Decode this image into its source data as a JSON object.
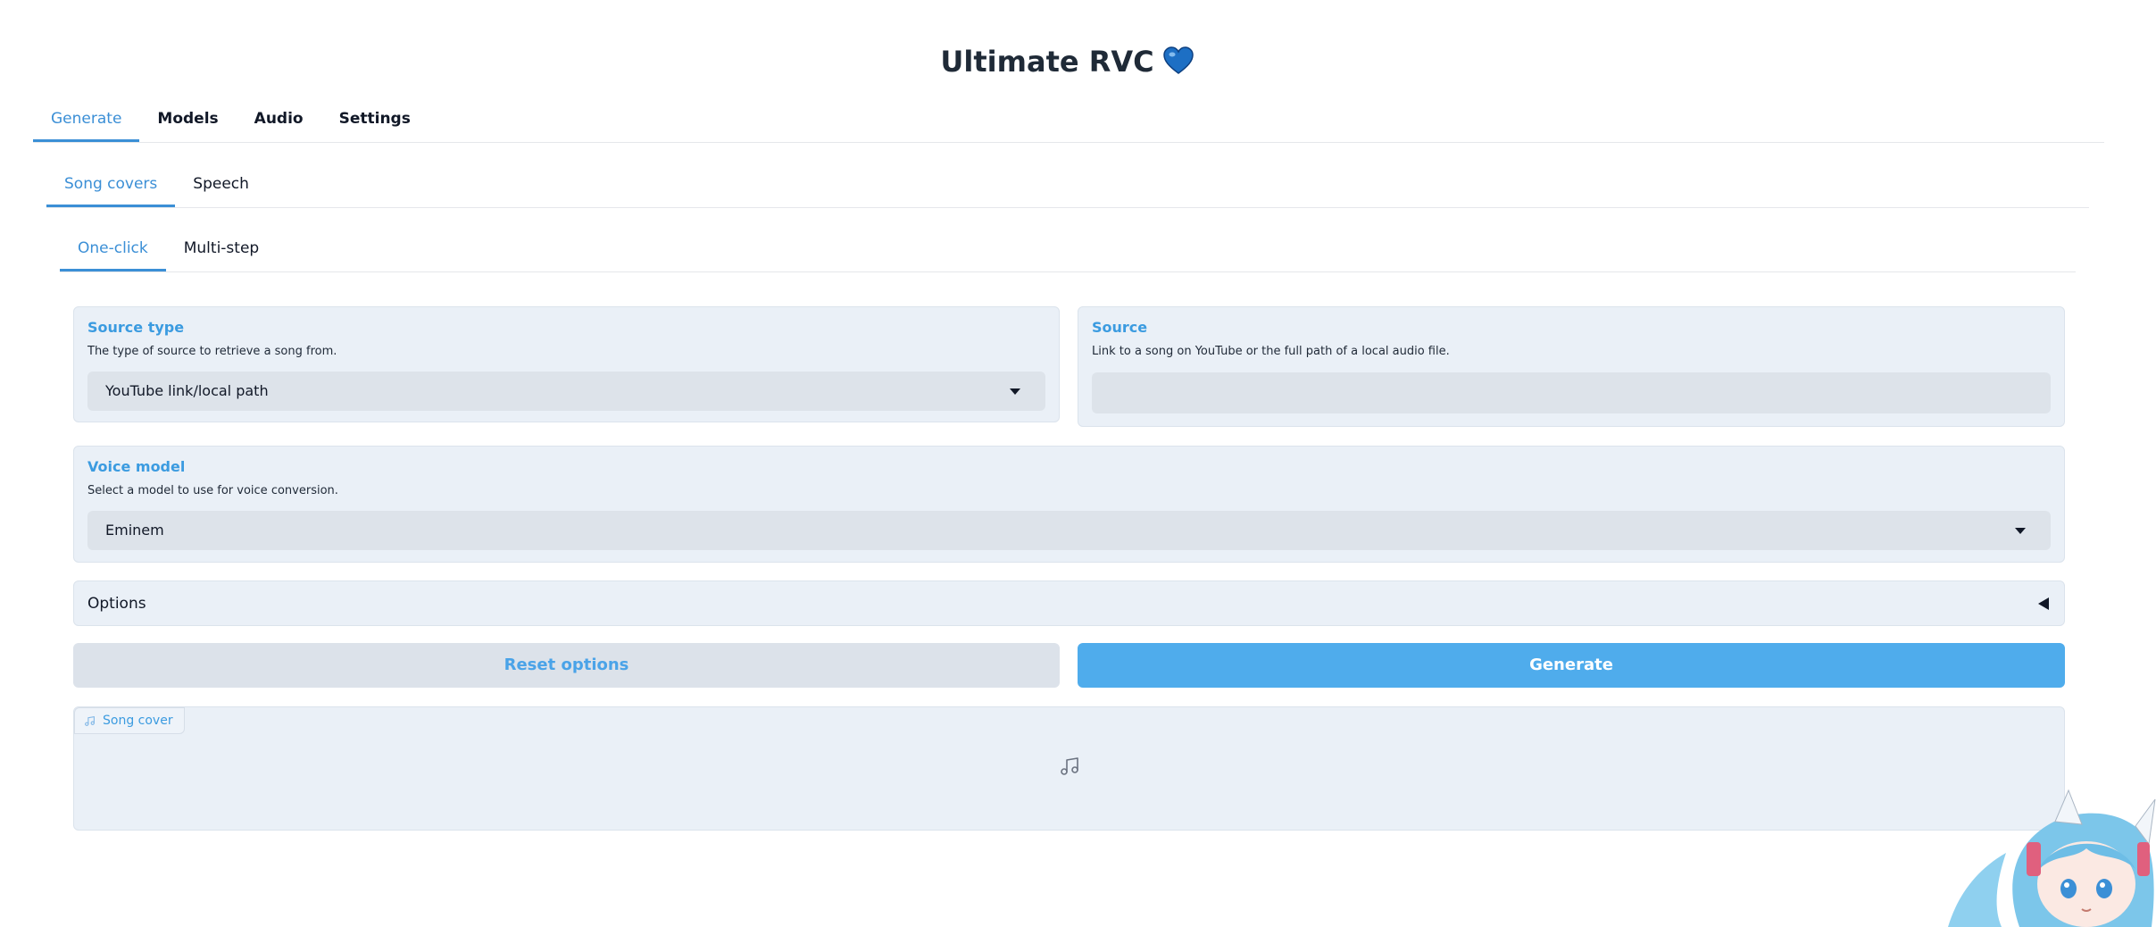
{
  "app": {
    "title": "Ultimate RVC",
    "title_icon": "blue-heart-icon",
    "accent_color": "#3b8fd6"
  },
  "main_tabs": [
    {
      "label": "Generate",
      "active": true
    },
    {
      "label": "Models",
      "active": false
    },
    {
      "label": "Audio",
      "active": false
    },
    {
      "label": "Settings",
      "active": false
    }
  ],
  "sub_tabs": [
    {
      "label": "Song covers",
      "active": true
    },
    {
      "label": "Speech",
      "active": false
    }
  ],
  "mode_tabs": [
    {
      "label": "One-click",
      "active": true
    },
    {
      "label": "Multi-step",
      "active": false
    }
  ],
  "source_type": {
    "label": "Source type",
    "info": "The type of source to retrieve a song from.",
    "value": "YouTube link/local path"
  },
  "source": {
    "label": "Source",
    "info": "Link to a song on YouTube or the full path of a local audio file.",
    "value": ""
  },
  "voice_model": {
    "label": "Voice model",
    "info": "Select a model to use for voice conversion.",
    "value": "Eminem"
  },
  "options": {
    "label": "Options",
    "expanded": false
  },
  "buttons": {
    "reset": "Reset options",
    "generate": "Generate"
  },
  "output": {
    "label": "Song cover",
    "icon": "music-note-icon"
  }
}
